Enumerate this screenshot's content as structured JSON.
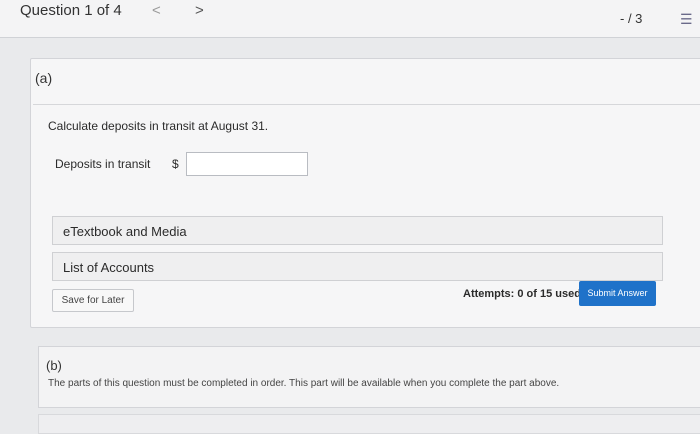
{
  "header": {
    "question_counter": "Question 1 of 4",
    "prev": "<",
    "next": ">",
    "score": "- / 3",
    "list_icon": "☰"
  },
  "part_a": {
    "label": "(a)",
    "question": "Calculate deposits in transit at August 31.",
    "field_label": "Deposits in transit",
    "currency": "$",
    "input_value": "",
    "input_placeholder": ""
  },
  "resources": [
    {
      "label": "eTextbook and Media"
    },
    {
      "label": "List of Accounts"
    }
  ],
  "actions": {
    "save_label": "Save for Later",
    "attempts_label": "Attempts: 0 of 15 used",
    "submit_label": "Submit Answer"
  },
  "part_b": {
    "label": "(b)",
    "note": "The parts of this question must be completed in order. This part will be available when you complete the part above."
  },
  "colors": {
    "accent": "#1f72c9",
    "background": "#e9eaec"
  }
}
